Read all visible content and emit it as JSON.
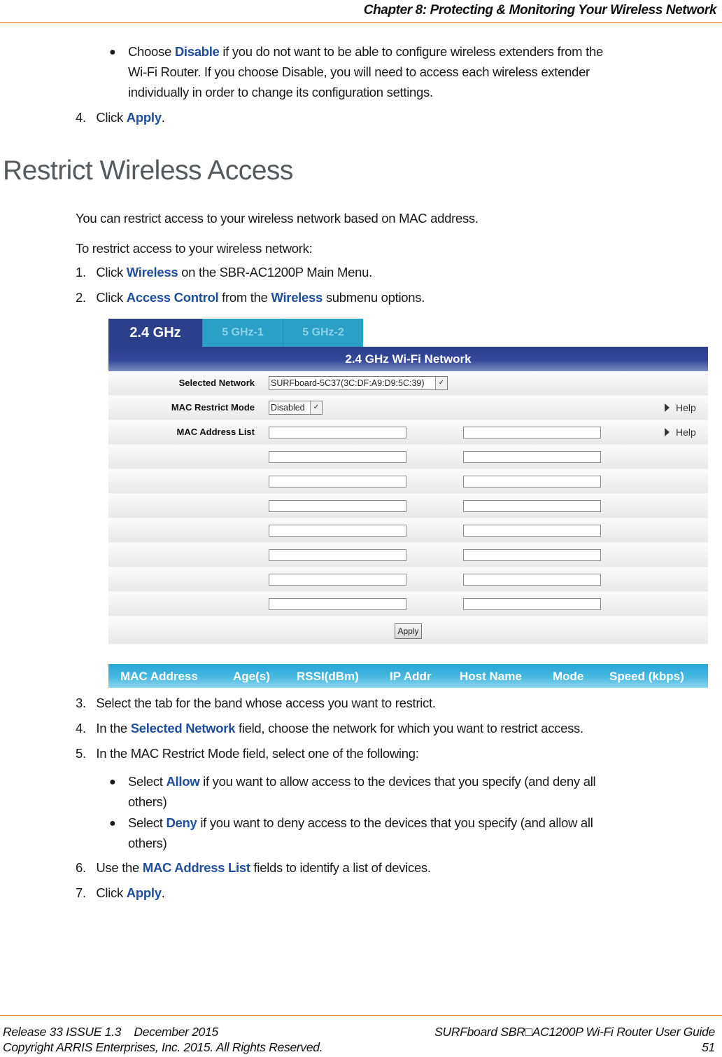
{
  "header": {
    "chapter_title": "Chapter 8: Protecting & Monitoring Your Wireless Network"
  },
  "intro": {
    "bullet_disable": {
      "prefix": "Choose ",
      "keyword": "Disable",
      "line1_rest": " if you do not want to be able to configure wireless extenders from the",
      "line2": "Wi-Fi Router.  If you choose Disable, you will need to access each wireless extender",
      "line3": "individually in order to change its configuration settings."
    },
    "step4": {
      "number": "4.",
      "prefix": "Click ",
      "keyword": "Apply",
      "suffix": "."
    }
  },
  "section": {
    "title": "Restrict Wireless Access",
    "para1": "You can restrict access to your wireless network based on MAC address.",
    "para2": "To restrict access to your wireless network:",
    "steps_before": [
      {
        "number": "1.",
        "prefix": "Click ",
        "keyword": "Wireless",
        "suffix": " on the SBR-AC1200P Main Menu."
      },
      {
        "number": "2.",
        "prefix": "Click ",
        "keyword": "Access Control",
        "middle": " from the ",
        "keyword2": "Wireless",
        "suffix": " submenu options."
      }
    ]
  },
  "router_ui": {
    "tabs": [
      {
        "label": "2.4 GHz",
        "active": true
      },
      {
        "label": "5 GHz-1",
        "active": false
      },
      {
        "label": "5 GHz-2",
        "active": false
      }
    ],
    "panel_title": "2.4 GHz Wi-Fi Network",
    "selected_network": {
      "label": "Selected Network",
      "value": "SURFboard-5C37(3C:DF:A9:D9:5C:39)"
    },
    "mac_restrict_mode": {
      "label": "MAC Restrict Mode",
      "value": "Disabled",
      "help": "Help"
    },
    "mac_address_list": {
      "label": "MAC Address List",
      "help": "Help",
      "rows": 8,
      "values": [
        "",
        "",
        "",
        "",
        "",
        "",
        "",
        "",
        "",
        "",
        "",
        "",
        "",
        "",
        "",
        ""
      ]
    },
    "apply_label": "Apply",
    "client_table_headers": [
      "MAC Address",
      "Age(s)",
      "RSSI(dBm)",
      "IP Addr",
      "Host Name",
      "Mode",
      "Speed (kbps)"
    ]
  },
  "steps_after": [
    {
      "number": "3.",
      "text": "Select the tab for the band whose access you want to restrict."
    },
    {
      "number": "4.",
      "prefix": "In the ",
      "keyword": "Selected Network",
      "suffix": " field, choose the network for which you want to restrict access."
    },
    {
      "number": "5.",
      "text": "In the MAC Restrict Mode field, select one of the following:"
    }
  ],
  "mode_bullets": [
    {
      "prefix": "Select ",
      "keyword": "Allow",
      "line1_rest": " if you want to allow access to the devices that you specify (and deny all",
      "line2": "others)"
    },
    {
      "prefix": "Select ",
      "keyword": "Deny",
      "line1_rest": " if you want to deny access to the devices that you specify (and allow all",
      "line2": "others)"
    }
  ],
  "steps_final": [
    {
      "number": "6.",
      "prefix": "Use the ",
      "keyword": "MAC Address List",
      "suffix": " fields to identify a list of devices."
    },
    {
      "number": "7.",
      "prefix": "Click ",
      "keyword": "Apply",
      "suffix": "."
    }
  ],
  "footer": {
    "release": "Release 33 ISSUE 1.3    December 2015",
    "copyright": "Copyright ARRIS Enterprises, Inc. 2015. All Rights Reserved.",
    "guide_title": "SURFboard SBR□AC1200P Wi-Fi Router User Guide",
    "page_number": "51"
  },
  "colors": {
    "keyword": "#1f4e9c",
    "rule": "#e07b2c",
    "tab_active": "#2b3f8a",
    "tab_inactive": "#2aa0c6",
    "client_header": "#28a7d8"
  }
}
